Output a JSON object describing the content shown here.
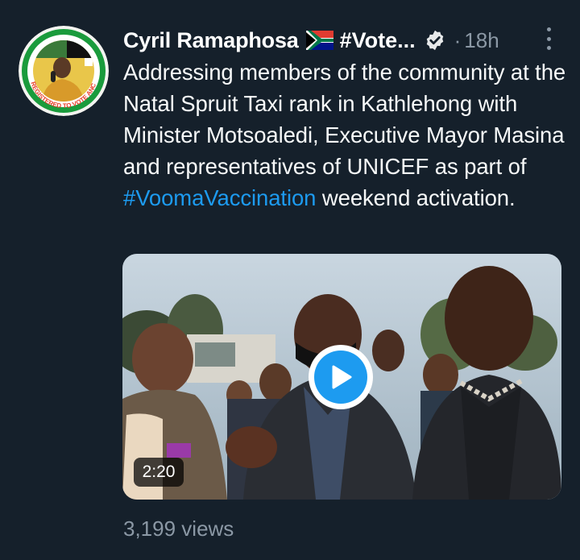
{
  "author": {
    "name": "Cyril Ramaphosa",
    "flag_icon": "south-africa-flag-icon",
    "hashtag_truncated": "#Vote...",
    "verified_icon": "verified-badge-icon",
    "separator": "·",
    "time": "18h"
  },
  "avatar": {
    "badge_text": "REGISTERED TO VOTE ANC",
    "ring_color": "#1a9b3c"
  },
  "tweet": {
    "text_before": "Addressing members of the community at the Natal Spruit Taxi rank in Kathlehong with Minister Motsoaledi, Executive Mayor Masina and representatives of UNICEF as part of ",
    "hashtag": "#VoomaVaccination",
    "text_after": " weekend activation."
  },
  "media": {
    "type": "video",
    "duration": "2:20",
    "play_icon": "play-icon"
  },
  "stats": {
    "views": "3,199 views"
  },
  "colors": {
    "background": "#15202b",
    "accent": "#1d9bf0",
    "secondary_text": "#8b98a5"
  }
}
